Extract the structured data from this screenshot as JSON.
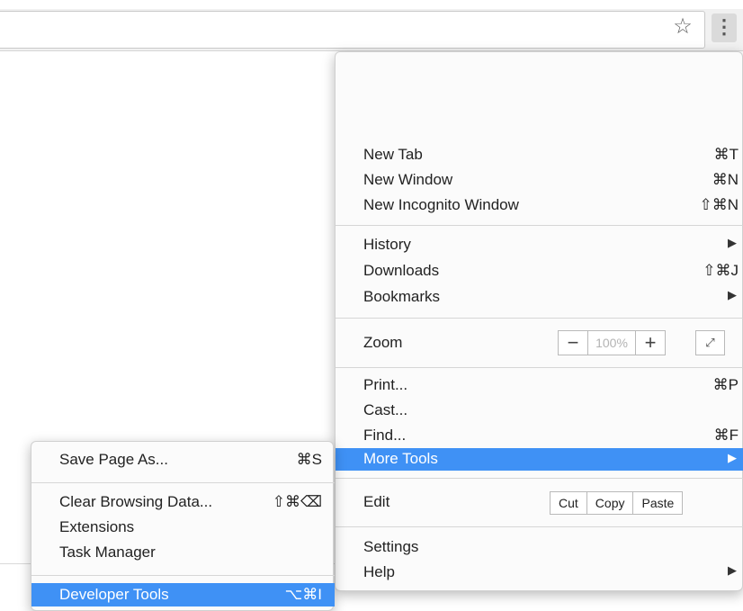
{
  "toolbar": {
    "bookmark_star_glyph": "☆",
    "menu_glyph": "⋮"
  },
  "menu": {
    "new_tab": {
      "label": "New Tab",
      "shortcut": "⌘T"
    },
    "new_window": {
      "label": "New Window",
      "shortcut": "⌘N"
    },
    "new_incognito": {
      "label": "New Incognito Window",
      "shortcut": "⇧⌘N"
    },
    "history": {
      "label": "History",
      "arrow": "▶"
    },
    "downloads": {
      "label": "Downloads",
      "shortcut": "⇧⌘J"
    },
    "bookmarks": {
      "label": "Bookmarks",
      "arrow": "▶"
    },
    "zoom": {
      "label": "Zoom",
      "minus": "−",
      "value": "100%",
      "plus": "+",
      "fullscreen": "⤢"
    },
    "print": {
      "label": "Print...",
      "shortcut": "⌘P"
    },
    "cast": {
      "label": "Cast..."
    },
    "find": {
      "label": "Find...",
      "shortcut": "⌘F"
    },
    "more_tools": {
      "label": "More Tools",
      "arrow": "▶"
    },
    "edit": {
      "label": "Edit",
      "cut": "Cut",
      "copy": "Copy",
      "paste": "Paste"
    },
    "settings": {
      "label": "Settings"
    },
    "help": {
      "label": "Help",
      "arrow": "▶"
    }
  },
  "submenu": {
    "save_page": {
      "label": "Save Page As...",
      "shortcut": "⌘S"
    },
    "clear_data": {
      "label": "Clear Browsing Data...",
      "shortcut": "⇧⌘⌫"
    },
    "extensions": {
      "label": "Extensions"
    },
    "task_manager": {
      "label": "Task Manager"
    },
    "developer_tools": {
      "label": "Developer Tools",
      "shortcut": "⌥⌘I"
    }
  },
  "colors": {
    "highlight": "#3f91f5",
    "menu_bg": "#fbfbfb"
  }
}
